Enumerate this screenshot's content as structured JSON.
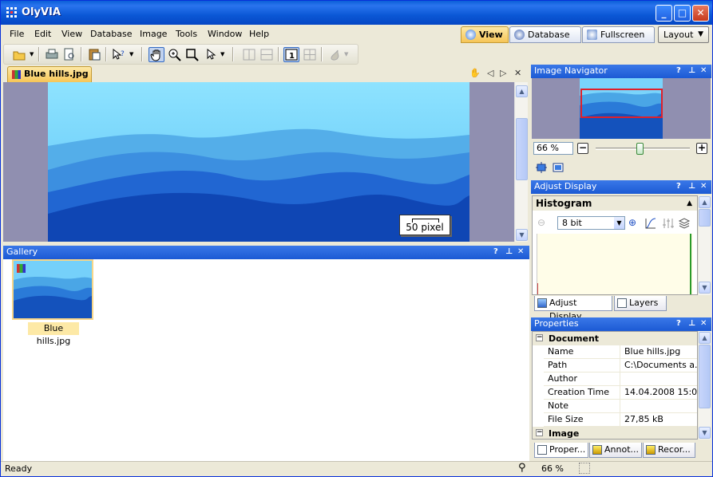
{
  "window": {
    "title": "OlyVIA",
    "minimize": "_",
    "maximize": "□",
    "close": "✕"
  },
  "menu": [
    "File",
    "Edit",
    "View",
    "Database",
    "Image",
    "Tools",
    "Window",
    "Help"
  ],
  "view_tabs": {
    "view": "View",
    "database": "Database",
    "fullscreen": "Fullscreen"
  },
  "layout_label": "Layout",
  "document_tab": {
    "label": "Blue hills.jpg"
  },
  "scale_bar": {
    "label": "50 pixel"
  },
  "gallery": {
    "title": "Gallery",
    "item_label": "Blue hills.jpg"
  },
  "image_navigator": {
    "title": "Image Navigator",
    "zoom": "66 %"
  },
  "adjust_display": {
    "title": "Adjust Display",
    "histogram_title": "Histogram",
    "bit_depth": "8 bit",
    "tabs": [
      "Adjust Display",
      "Layers"
    ]
  },
  "properties": {
    "title": "Properties",
    "categories": {
      "document": "Document",
      "image": "Image"
    },
    "rows": [
      {
        "key": "Name",
        "value": "Blue hills.jpg"
      },
      {
        "key": "Path",
        "value": "C:\\Documents a..."
      },
      {
        "key": "Author",
        "value": ""
      },
      {
        "key": "Creation Time",
        "value": "14.04.2008 15:0..."
      },
      {
        "key": "Note",
        "value": ""
      },
      {
        "key": "File Size",
        "value": "27,85 kB"
      }
    ],
    "tabs": [
      "Proper...",
      "Annot...",
      "Recor..."
    ]
  },
  "panel_buttons": {
    "help": "?",
    "pin": "⊥",
    "close": "✕"
  },
  "status": {
    "text": "Ready",
    "zoom": "66 %"
  }
}
